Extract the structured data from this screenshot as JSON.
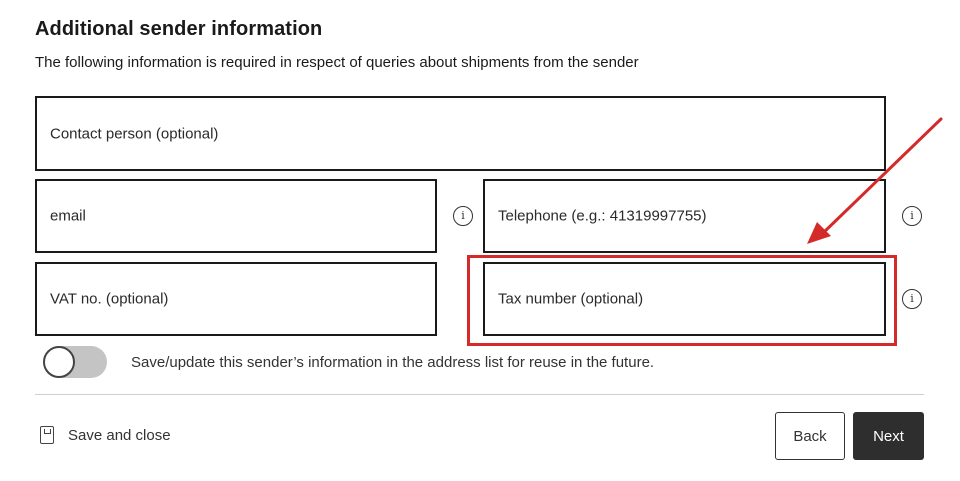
{
  "heading": "Additional sender information",
  "subheading": "The following information is required in respect of queries about shipments from the sender",
  "fields": {
    "contact": {
      "placeholder": "Contact person (optional)"
    },
    "email": {
      "placeholder": "email"
    },
    "telephone": {
      "placeholder": "Telephone (e.g.: 41319997755)"
    },
    "vat": {
      "placeholder": "VAT no. (optional)"
    },
    "tax": {
      "placeholder": "Tax number (optional)"
    }
  },
  "info_icon": "i",
  "toggle": {
    "label": "Save/update this sender’s information in the address list for reuse in the future.",
    "on": false
  },
  "footer": {
    "save_close_label": "Save and close",
    "back_label": "Back",
    "next_label": "Next"
  },
  "colors": {
    "annotation": "#d42a2a",
    "primary_button": "#2e2e2e",
    "toggle_track": "#c4c4c4"
  },
  "icons": {
    "info": "info-icon",
    "save": "save-icon"
  }
}
